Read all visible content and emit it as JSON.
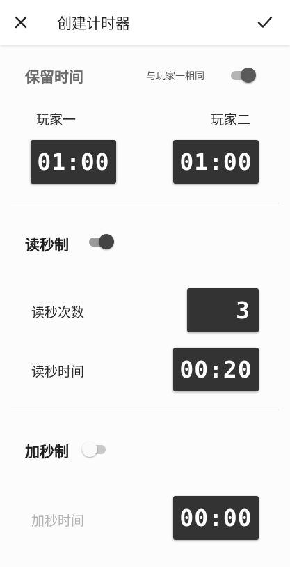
{
  "appbar": {
    "title": "创建计时器"
  },
  "reserve": {
    "title": "保留时间",
    "same_label": "与玩家一相同",
    "same_enabled": true,
    "player1_label": "玩家一",
    "player2_label": "玩家二",
    "player1_time": "01:00",
    "player2_time": "01:00"
  },
  "byoyomi": {
    "title": "读秒制",
    "enabled": true,
    "count_label": "读秒次数",
    "count_value": "3",
    "time_label": "读秒时间",
    "time_value": "00:20"
  },
  "increment": {
    "title": "加秒制",
    "enabled": false,
    "time_label": "加秒时间",
    "time_value": "00:00"
  }
}
